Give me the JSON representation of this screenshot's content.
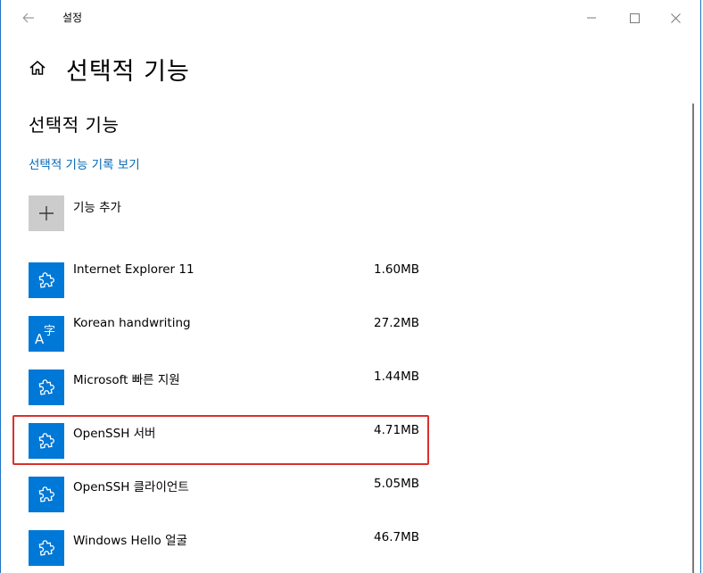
{
  "window": {
    "app_title": "설정"
  },
  "header": {
    "page_title": "선택적 기능"
  },
  "main": {
    "section_title": "선택적 기능",
    "history_link": "선택적 기능 기록 보기",
    "add_feature_label": "기능 추가",
    "features": [
      {
        "name": "Internet Explorer 11",
        "size": "1.60MB",
        "icon": "puzzle-icon"
      },
      {
        "name": "Korean handwriting",
        "size": "27.2MB",
        "icon": "language-icon"
      },
      {
        "name": "Microsoft 빠른 지원",
        "size": "1.44MB",
        "icon": "puzzle-icon"
      },
      {
        "name": "OpenSSH 서버",
        "size": "4.71MB",
        "icon": "puzzle-icon"
      },
      {
        "name": "OpenSSH 클라이언트",
        "size": "5.05MB",
        "icon": "puzzle-icon"
      },
      {
        "name": "Windows Hello 얼굴",
        "size": "46.7MB",
        "icon": "puzzle-icon"
      }
    ]
  },
  "colors": {
    "accent": "#0078d7",
    "link": "#0067b8",
    "highlight": "#d9312b",
    "add_tile": "#cccccc"
  }
}
